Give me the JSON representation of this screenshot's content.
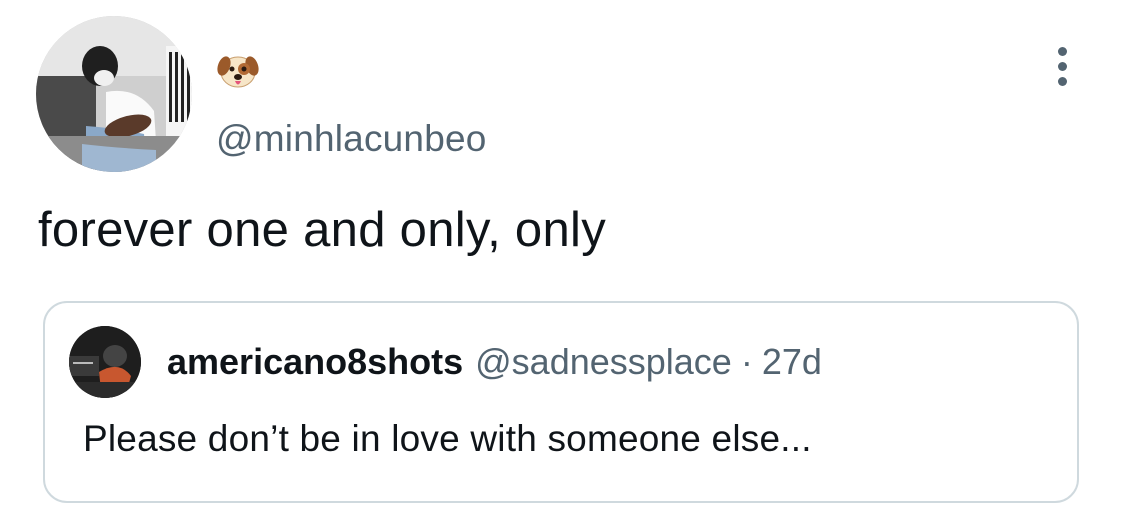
{
  "tweet": {
    "name_emoji": "dog-face-emoji",
    "handle": "@minhlacunbeo",
    "text": "forever one and only, only"
  },
  "quoted_tweet": {
    "name": "americano8shots",
    "handle": "@sadnessplace",
    "separator": "·",
    "time": "27d",
    "text": "Please don’t be in love with someone else..."
  },
  "colors": {
    "text_primary": "#0f1419",
    "text_secondary": "#536471",
    "card_border": "#cfd9de",
    "background": "#ffffff"
  },
  "icons": {
    "more": "more-vertical-icon"
  }
}
